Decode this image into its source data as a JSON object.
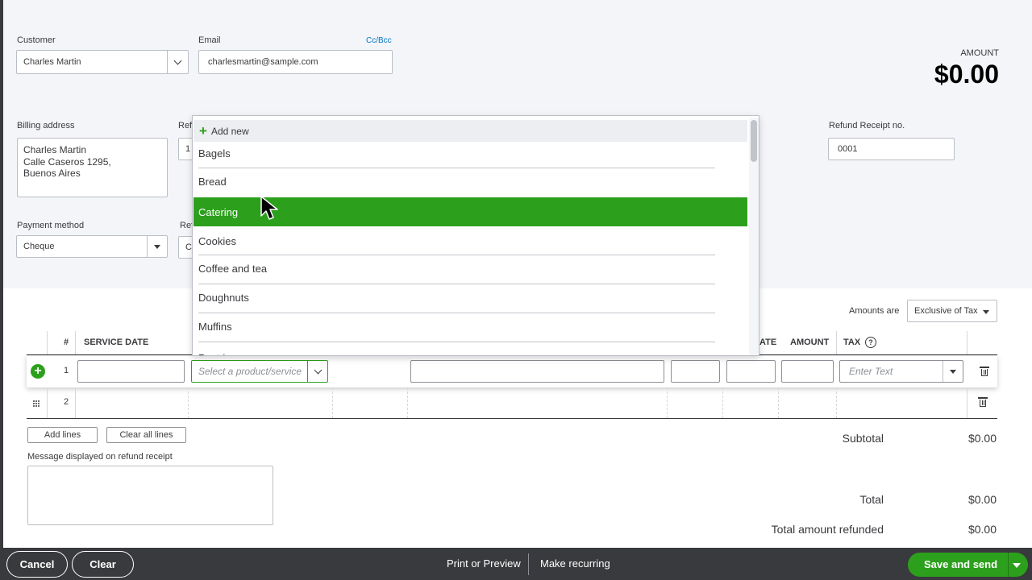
{
  "customer": {
    "label": "Customer",
    "value": "Charles Martin"
  },
  "email": {
    "label": "Email",
    "value": "charlesmartin@sample.com",
    "cc_bcc": "Cc/Bcc"
  },
  "amount": {
    "label": "AMOUNT",
    "value": "$0.00"
  },
  "billing": {
    "label": "Billing address",
    "lines": [
      "Charles Martin",
      "Calle Caseros 1295,",
      "Buenos Aires"
    ]
  },
  "ref_label_partial_1": "Ref",
  "ref_value_partial_1": "1",
  "ref_label_partial_2": "Ref",
  "ref_value_partial_2": "C",
  "refund_receipt_no": {
    "label": "Refund Receipt no.",
    "value": "0001"
  },
  "payment_method": {
    "label": "Payment method",
    "value": "Cheque"
  },
  "amounts_are": {
    "label": "Amounts are",
    "value": "Exclusive of Tax"
  },
  "table": {
    "headers": {
      "num": "#",
      "service_date": "SERVICE DATE",
      "rate_partial": "ATE",
      "amount": "AMOUNT",
      "tax": "TAX"
    },
    "rows": [
      {
        "num": "1"
      },
      {
        "num": "2"
      }
    ],
    "product_placeholder": "Select a product/service",
    "tax_placeholder": "Enter Text"
  },
  "dropdown": {
    "add_new": "Add new",
    "items": [
      "Bagels",
      "Bread",
      "Catering",
      "Cookies",
      "Coffee and tea",
      "Doughnuts",
      "Muffins",
      "Pastries"
    ],
    "highlighted": "Catering",
    "highlight_color": "#2ca01c"
  },
  "buttons": {
    "add_lines": "Add lines",
    "clear_all_lines": "Clear all lines"
  },
  "message": {
    "label": "Message displayed on refund receipt"
  },
  "totals": {
    "subtotal_label": "Subtotal",
    "subtotal_value": "$0.00",
    "total_label": "Total",
    "total_value": "$0.00",
    "refunded_label": "Total amount refunded",
    "refunded_value": "$0.00"
  },
  "footer": {
    "cancel": "Cancel",
    "clear": "Clear",
    "print_preview": "Print or Preview",
    "make_recurring": "Make recurring",
    "save_send": "Save and send",
    "accent": "#2ca01c"
  }
}
